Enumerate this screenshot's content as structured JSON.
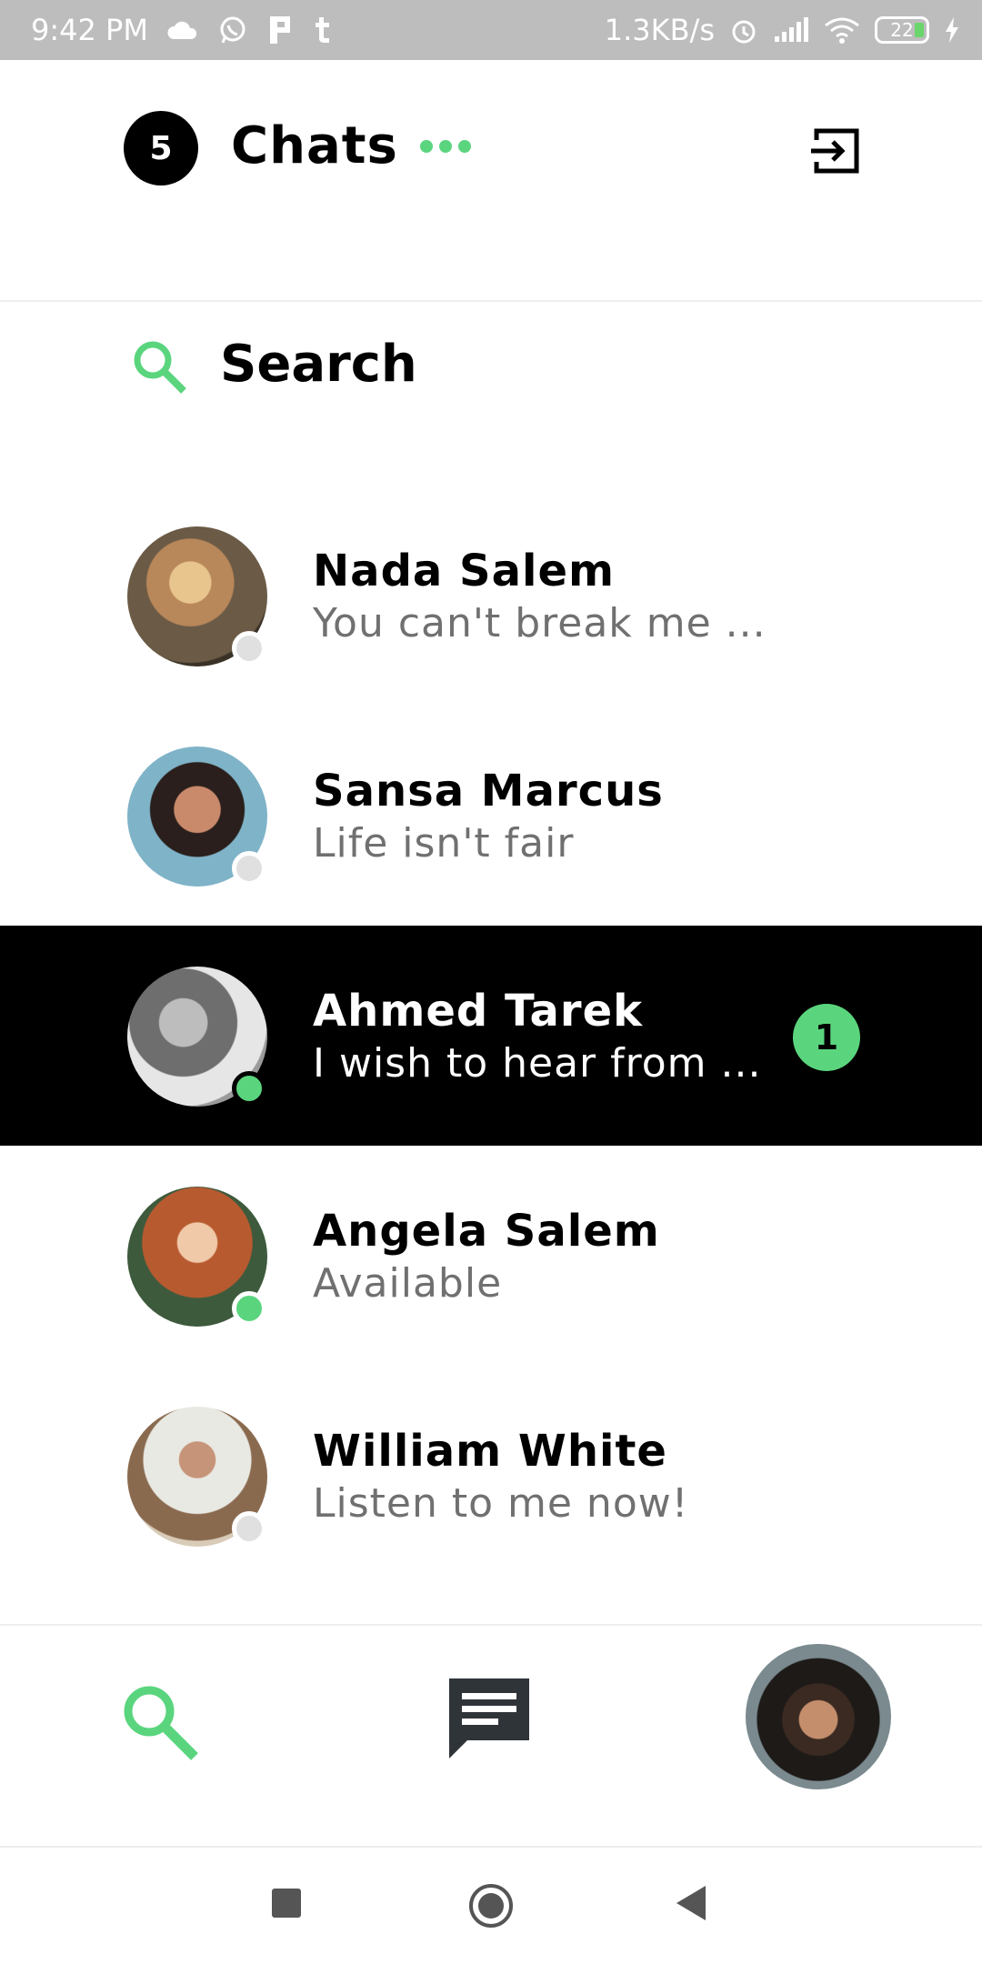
{
  "status_bar": {
    "time": "9:42 PM",
    "network_speed": "1.3KB/s",
    "battery": "22",
    "icons": [
      "cloud-icon",
      "whatsapp-icon",
      "p-app-icon",
      "tumblr-icon",
      "alarm-icon",
      "signal-icon",
      "wifi-icon",
      "battery-icon",
      "charging-icon"
    ]
  },
  "header": {
    "count": "5",
    "title": "Chats",
    "more_icon": "more-dots-icon",
    "logout_icon": "logout-icon"
  },
  "search": {
    "label": "Search",
    "icon": "search-icon"
  },
  "chats": [
    {
      "name": "Nada Salem",
      "message": "You can't break me ...",
      "online": false,
      "active": false,
      "unread": ""
    },
    {
      "name": "Sansa Marcus",
      "message": "Life isn't fair",
      "online": false,
      "active": false,
      "unread": ""
    },
    {
      "name": "Ahmed Tarek",
      "message": "I wish to hear from ...",
      "online": true,
      "active": true,
      "unread": "1"
    },
    {
      "name": "Angela Salem",
      "message": "Available",
      "online": true,
      "active": false,
      "unread": ""
    },
    {
      "name": "William White",
      "message": "Listen to me now!",
      "online": false,
      "active": false,
      "unread": ""
    }
  ],
  "bottom_nav": {
    "items": [
      "search-icon",
      "chat-icon",
      "profile-avatar"
    ]
  },
  "colors": {
    "accent": "#5ad57e",
    "active_row": "#000000",
    "offline_dot": "#e0e0e0",
    "status_bar": "#bdbdbd"
  }
}
